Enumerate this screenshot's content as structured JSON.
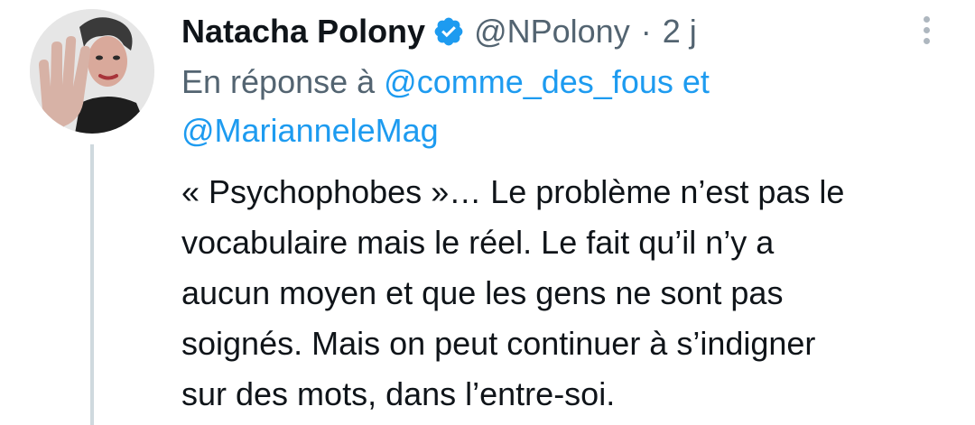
{
  "tweet": {
    "author": {
      "name": "Natacha Polony",
      "handle": "@NPolony",
      "verified": true
    },
    "separator": "·",
    "time": "2 j",
    "reply": {
      "prefix": "En réponse à",
      "mentions": [
        "@comme_des_fous",
        "@MarianneleMag"
      ],
      "conjunction": "et"
    },
    "text_lines": [
      "« Psychophobes »… Le problème n’est pas le",
      "vocabulaire mais le réel. Le fait qu’il n’y a",
      "aucun moyen et que les gens ne sont pas",
      "soignés. Mais on peut continuer à s’indigner",
      "sur des mots, dans l’entre-soi."
    ]
  },
  "colors": {
    "accent": "#1d9bf0",
    "secondary_text": "#536471",
    "primary_text": "#0f1419",
    "thread_line": "#cfd9de"
  },
  "icons": {
    "verified": "verified-badge-icon",
    "more": "more-vertical-icon"
  }
}
